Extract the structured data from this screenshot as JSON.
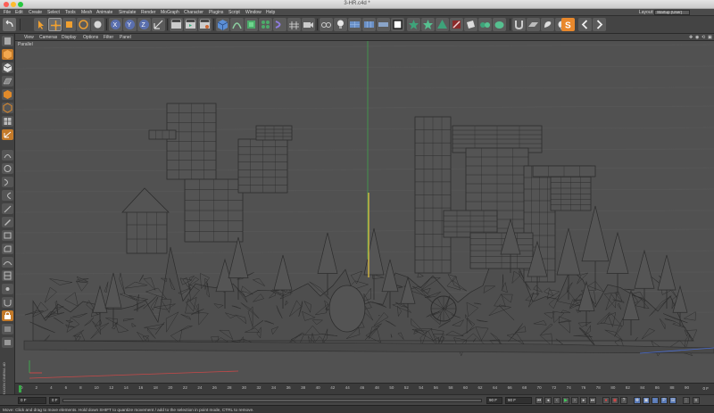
{
  "window": {
    "title": "3-HR.c4d *"
  },
  "menubar": {
    "items": [
      "File",
      "Edit",
      "Create",
      "Select",
      "Tools",
      "Mesh",
      "Animate",
      "Simulate",
      "Render",
      "MoGraph",
      "Character",
      "Plugins",
      "Script",
      "Window",
      "Help"
    ],
    "layout_label": "Layout:",
    "layout_value": "Startup (User)"
  },
  "viewport": {
    "menu": [
      "View",
      "Cameras",
      "Display",
      "Options",
      "Filter",
      "Panel"
    ],
    "label": "Parallel",
    "nav_icons": [
      "move-view-icon",
      "rotate-view-icon",
      "zoom-view-icon",
      "toggle-views-icon"
    ]
  },
  "timeline": {
    "ticks": [
      "0",
      "2",
      "4",
      "6",
      "8",
      "10",
      "12",
      "14",
      "16",
      "18",
      "20",
      "22",
      "24",
      "26",
      "28",
      "30",
      "32",
      "34",
      "36",
      "38",
      "40",
      "42",
      "44",
      "46",
      "48",
      "50",
      "52",
      "54",
      "56",
      "58",
      "60",
      "62",
      "64",
      "66",
      "68",
      "70",
      "72",
      "74",
      "76",
      "78",
      "80",
      "82",
      "84",
      "86",
      "88",
      "90"
    ],
    "current_frame": "0 F"
  },
  "controls": {
    "start_frame": "0 F",
    "preview_start": "0 F",
    "preview_end": "90 F",
    "end_frame": "90 F"
  },
  "status": {
    "text": "Move: Click and drag to move elements. Hold down SHIFT to quantize movement / add to the selection in point mode, CTRL to remove."
  },
  "colors": {
    "viewport_bg": "#515151",
    "wire": "#2d2d2d",
    "y_axis": "#3fa34d",
    "selected_edge": "#e0c040",
    "x_axis": "#c84848",
    "z_axis": "#4a6cd0"
  }
}
